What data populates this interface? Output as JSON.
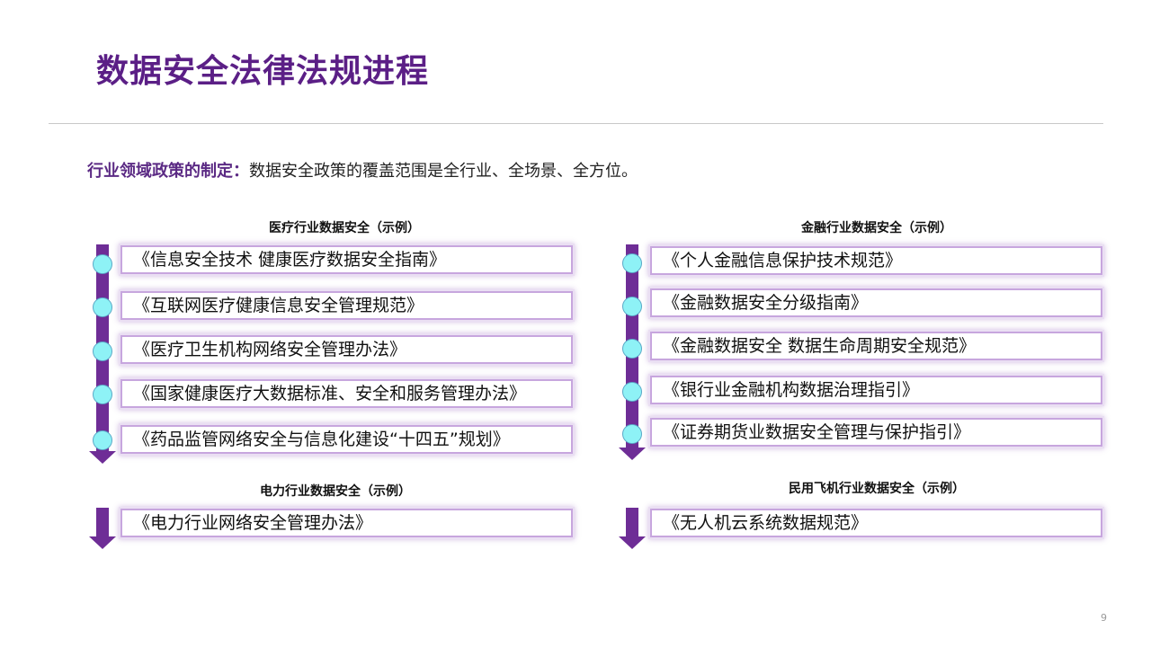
{
  "slide": {
    "title": "数据安全法律法规进程",
    "subtitle_key": "行业领域政策的制定：",
    "subtitle_text": "数据安全政策的覆盖范围是全行业、全场景、全方位。",
    "page_number": "9"
  },
  "sections": {
    "medical": {
      "heading": "医疗行业数据安全（示例）",
      "items": [
        "《信息安全技术 健康医疗数据安全指南》",
        "《互联网医疗健康信息安全管理规范》",
        "《医疗卫生机构网络安全管理办法》",
        "《国家健康医疗大数据标准、安全和服务管理办法》",
        "《药品监管网络安全与信息化建设“十四五”规划》"
      ]
    },
    "finance": {
      "heading": "金融行业数据安全（示例）",
      "items": [
        "《个人金融信息保护技术规范》",
        "《金融数据安全分级指南》",
        "《金融数据安全 数据生命周期安全规范》",
        "《银行业金融机构数据治理指引》",
        "《证券期货业数据安全管理与保护指引》"
      ]
    },
    "power": {
      "heading": "电力行业数据安全（示例）",
      "items": [
        "《电力行业网络安全管理办法》"
      ]
    },
    "aviation": {
      "heading": "民用飞机行业数据安全（示例）",
      "items": [
        "《无人机云系统数据规范》"
      ]
    }
  }
}
